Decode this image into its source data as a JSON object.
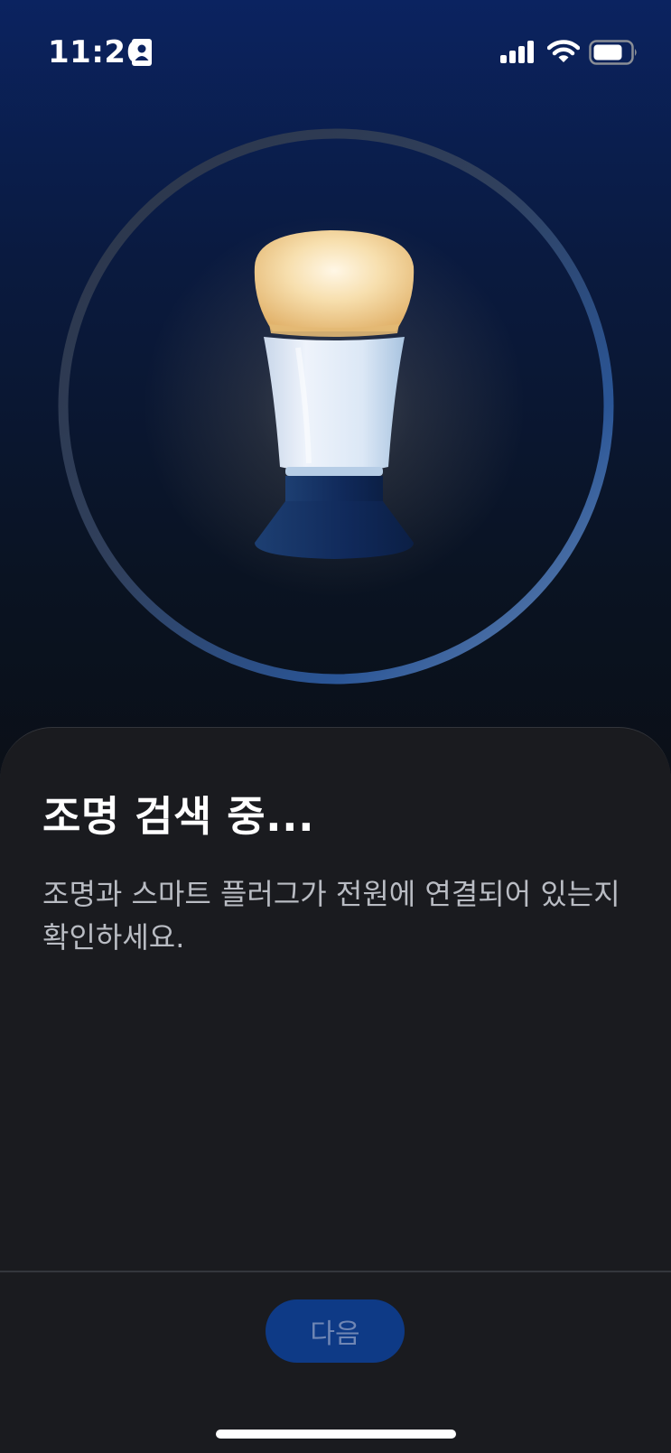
{
  "status_bar": {
    "time": "11:26",
    "icons": [
      "contact-card-icon",
      "cellular-signal-icon",
      "wifi-icon",
      "battery-icon"
    ]
  },
  "hero": {
    "illustration": "light-bulb-icon",
    "ring_color": "#3a6db3",
    "bulb_glow_color": "#f6d9a5"
  },
  "sheet": {
    "title": "조명 검색 중...",
    "description": "조명과 스마트 플러그가 전원에 연결되어 있는지 확인하세요."
  },
  "footer": {
    "next_label": "다음",
    "button_color": "#0e3a86"
  }
}
